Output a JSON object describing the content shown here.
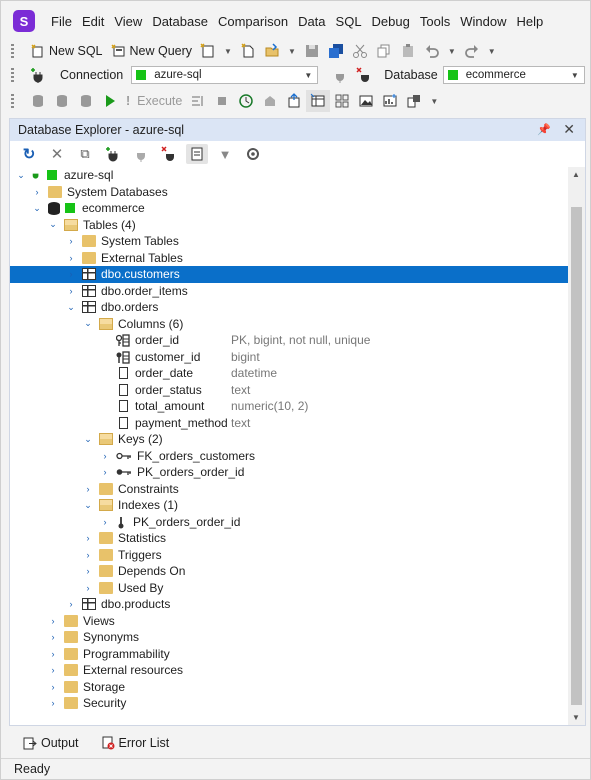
{
  "menu": [
    "File",
    "Edit",
    "View",
    "Database",
    "Comparison",
    "Data",
    "SQL",
    "Debug",
    "Tools",
    "Window",
    "Help"
  ],
  "toolbar1": {
    "new_sql": "New SQL",
    "new_query": "New Query"
  },
  "toolbar2": {
    "connection_label": "Connection",
    "connection_value": "azure-sql",
    "database_label": "Database",
    "database_value": "ecommerce"
  },
  "toolbar3": {
    "execute": "Execute"
  },
  "explorer": {
    "title": "Database Explorer - azure-sql",
    "nodes": [
      {
        "label": "azure-sql"
      },
      {
        "label": "System Databases"
      },
      {
        "label": "ecommerce"
      },
      {
        "label": "Tables (4)"
      },
      {
        "label": "System Tables"
      },
      {
        "label": "External Tables"
      },
      {
        "label": "dbo.customers"
      },
      {
        "label": "dbo.order_items"
      },
      {
        "label": "dbo.orders"
      },
      {
        "label": "Columns (6)"
      },
      {
        "label": "order_id",
        "detail": "PK, bigint, not null, unique"
      },
      {
        "label": "customer_id",
        "detail": "bigint"
      },
      {
        "label": "order_date",
        "detail": "datetime"
      },
      {
        "label": "order_status",
        "detail": "text"
      },
      {
        "label": "total_amount",
        "detail": "numeric(10, 2)"
      },
      {
        "label": "payment_method",
        "detail": "text"
      },
      {
        "label": "Keys (2)"
      },
      {
        "label": "FK_orders_customers"
      },
      {
        "label": "PK_orders_order_id"
      },
      {
        "label": "Constraints"
      },
      {
        "label": "Indexes (1)"
      },
      {
        "label": "PK_orders_order_id"
      },
      {
        "label": "Statistics"
      },
      {
        "label": "Triggers"
      },
      {
        "label": "Depends On"
      },
      {
        "label": "Used By"
      },
      {
        "label": "dbo.products"
      },
      {
        "label": "Views"
      },
      {
        "label": "Synonyms"
      },
      {
        "label": "Programmability"
      },
      {
        "label": "External resources"
      },
      {
        "label": "Storage"
      },
      {
        "label": "Security"
      }
    ]
  },
  "bottom_tabs": {
    "output": "Output",
    "error_list": "Error List"
  },
  "status": {
    "text": "Ready"
  },
  "colors": {
    "selection": "#0a6fc9",
    "accent": "#7b2cd6",
    "connection_green": "#16c316"
  }
}
